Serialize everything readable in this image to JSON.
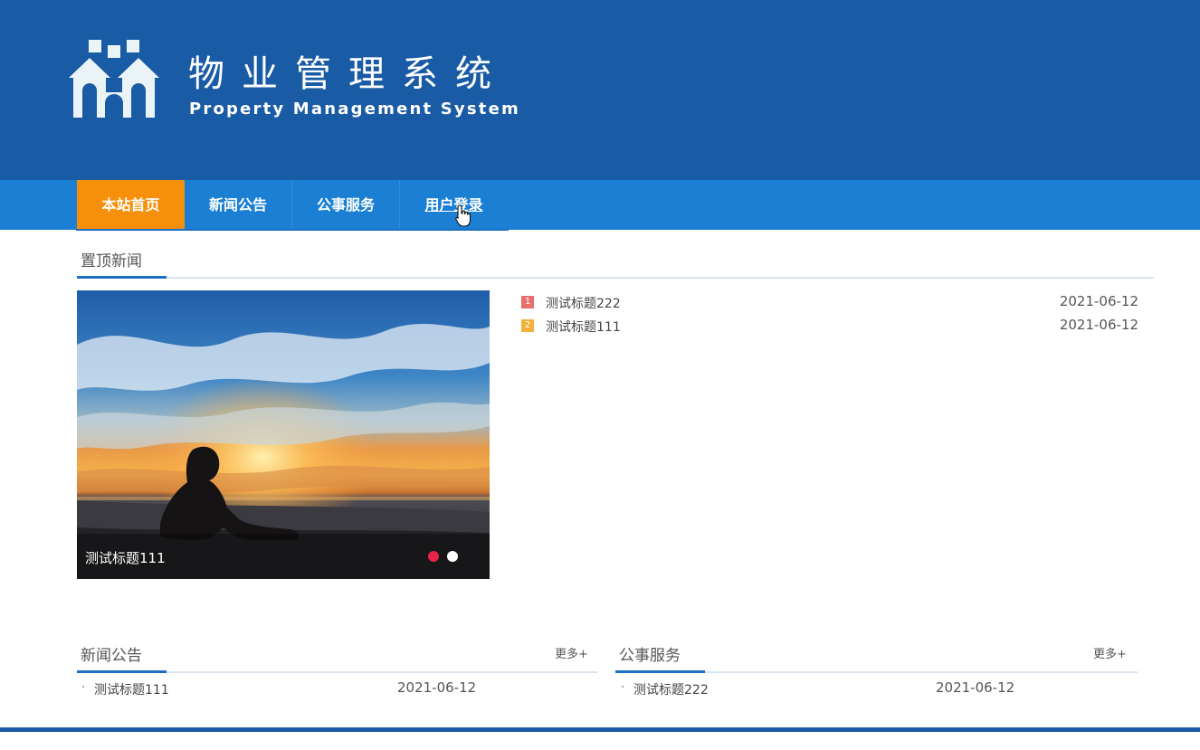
{
  "header": {
    "title_cn": "物业管理系统",
    "title_en": "Property Management System",
    "background_color": "#1a5ba6",
    "logo_icon": "houses-logo-icon"
  },
  "nav": {
    "bar_color": "#1b7fd3",
    "active_color": "#f6900a",
    "items": [
      {
        "label": "本站首页",
        "active": true
      },
      {
        "label": "新闻公告",
        "active": false
      },
      {
        "label": "公事服务",
        "active": false
      },
      {
        "label": "用户登录",
        "active": false,
        "hovered": true
      }
    ]
  },
  "top_news": {
    "section_title": "置顶新闻",
    "slider": {
      "caption": "测试标题111",
      "slide_count": 2,
      "active_slide": 1,
      "active_dot_color": "#e8234a",
      "inactive_dot_color": "#ffffff"
    },
    "list": [
      {
        "rank": "1",
        "title": "测试标题222",
        "date": "2021-06-12",
        "badge_color": "#e66f6f"
      },
      {
        "rank": "2",
        "title": "测试标题111",
        "date": "2021-06-12",
        "badge_color": "#f2b13b"
      }
    ]
  },
  "news_section": {
    "title": "新闻公告",
    "more_label": "更多+",
    "items": [
      {
        "bullet": "·",
        "title": "测试标题111",
        "date": "2021-06-12"
      }
    ]
  },
  "service_section": {
    "title": "公事服务",
    "more_label": "更多+",
    "items": [
      {
        "bullet": "·",
        "title": "测试标题222",
        "date": "2021-06-12"
      }
    ]
  },
  "accent_color": "#1a6fc4"
}
